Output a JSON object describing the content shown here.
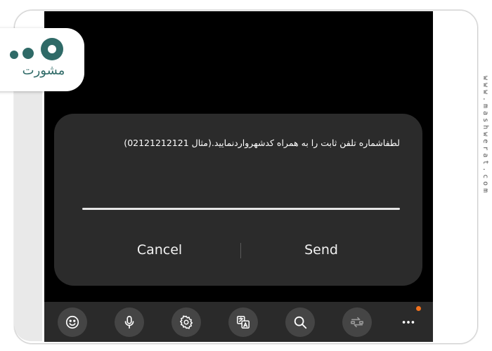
{
  "dialog": {
    "prompt": "لطفاشماره تلفن ثابت را به همراه کدشهرواردنمایید.(مثال 02121212121)",
    "cancel_label": "Cancel",
    "send_label": "Send"
  },
  "toolbar": {
    "items": [
      "emoji-icon",
      "microphone-icon",
      "gear-icon",
      "translate-icon",
      "search-icon",
      "swap-icon",
      "more-icon"
    ],
    "notification_color": "#f2711c"
  },
  "brand": {
    "logo_text": "مشورت",
    "website": "www.mashwerat.com",
    "accent_color": "#2f6a67"
  }
}
